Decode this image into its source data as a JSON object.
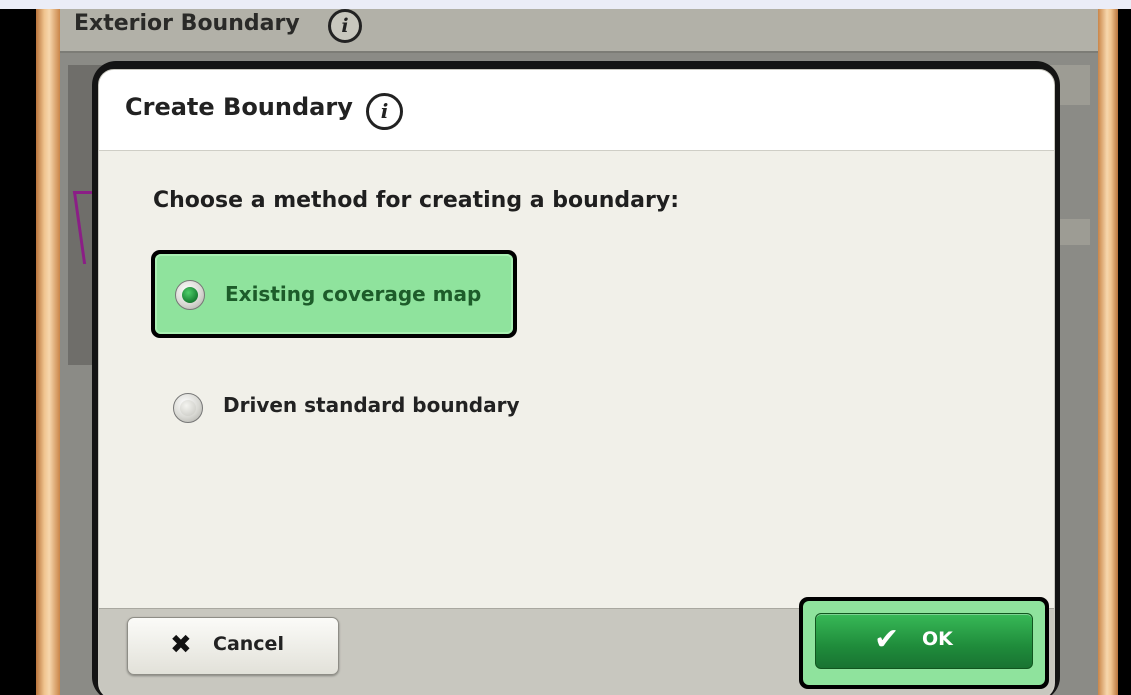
{
  "background": {
    "title": "Exterior Boundary",
    "info_icon": "i"
  },
  "dialog": {
    "title": "Create Boundary",
    "info_icon": "i",
    "prompt": "Choose a method for creating a boundary:",
    "options": [
      {
        "label": "Existing coverage map",
        "selected": true
      },
      {
        "label": "Driven standard boundary",
        "selected": false
      }
    ],
    "cancel": {
      "label": "Cancel",
      "icon": "✖"
    },
    "ok": {
      "label": "OK",
      "icon": "✔"
    }
  },
  "colors": {
    "selected_fill": "#8fe39d",
    "ok_green": "#1f8c3b",
    "frame_wood": "#f0c48f"
  }
}
